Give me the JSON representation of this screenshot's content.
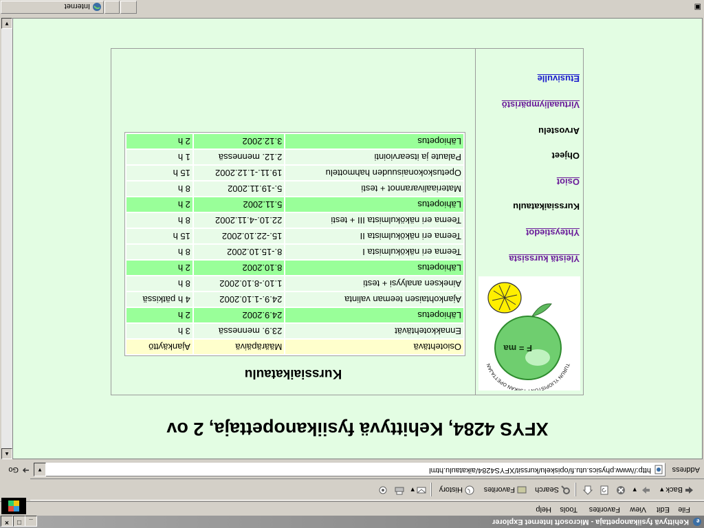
{
  "window": {
    "title": "Kehittyvä fysiikanopettaja - Microsoft Internet Explorer",
    "min_label": "_",
    "max_label": "□",
    "close_label": "×"
  },
  "menu": [
    "File",
    "Edit",
    "View",
    "Favorites",
    "Tools",
    "Help"
  ],
  "toolbar": {
    "back": "Back",
    "forward_icon": "arrow-right-icon",
    "search": "Search",
    "favorites": "Favorites",
    "history": "History"
  },
  "address": {
    "label": "Address",
    "url": "http://www.physics.utu.fi/opiskelu/kurssit/XFYS4284/aikataulu.html",
    "go": "Go"
  },
  "page": {
    "title": "XFYS 4284, Kehittyvä fysiikanopettaja, 2 ov",
    "schedule_title": "Kurssiaikataulu",
    "nav": [
      {
        "label": "Yleistä kurssista",
        "style": "visited"
      },
      {
        "label": "Yhteystiedot",
        "style": "visited"
      },
      {
        "label": "Kurssiaikataulu",
        "style": "plain"
      },
      {
        "label": "Osiot",
        "style": "visited"
      },
      {
        "label": "Ohjeet",
        "style": "plain"
      },
      {
        "label": "Arvostelu",
        "style": "plain"
      },
      {
        "label": "Virtuaaliympäristö",
        "style": "visited"
      },
      {
        "label": "Etusivulle",
        "style": "link"
      }
    ],
    "table_header": [
      "Osiotehtävä",
      "Määräpäivä",
      "Ajankäyttö"
    ],
    "rows": [
      {
        "task": "Ennakkotehtävät",
        "date": "23.9. mennessä",
        "time": "3 h",
        "type": "normal"
      },
      {
        "task": "Lähiopetus",
        "date": "24.9.2002",
        "time": "2 h",
        "type": "contact"
      },
      {
        "task": "Ajankohtaisen teeman valinta",
        "date": "24.9.-1.10.2002",
        "time": "4 h pätkissä",
        "type": "normal"
      },
      {
        "task": "Aineksen analyysi + testi",
        "date": "1.10.-8.10.2002",
        "time": "8 h",
        "type": "normal"
      },
      {
        "task": "Lähiopetus",
        "date": "8.10.2002",
        "time": "2 h",
        "type": "contact"
      },
      {
        "task": "Teema eri näkökulmista I",
        "date": "8.-15.10.2002",
        "time": "8 h",
        "type": "normal"
      },
      {
        "task": "Teema eri näkökulmista II",
        "date": "15.-22.10.2002",
        "time": "15 h",
        "type": "normal"
      },
      {
        "task": "Teema eri näkökulmista III + testi",
        "date": "22.10.-4.11.2002",
        "time": "8 h",
        "type": "normal"
      },
      {
        "task": "Lähiopetus",
        "date": "5.11.2002",
        "time": "2 h",
        "type": "contact"
      },
      {
        "task": "Materiaalivarannot + testi",
        "date": "5.-19.11.2002",
        "time": "8 h",
        "type": "normal"
      },
      {
        "task": "Opetuskokonaisuuden hahmottelu",
        "date": "19.11.-1.12.2002",
        "time": "15 h",
        "type": "normal"
      },
      {
        "task": "Palaute ja itsearviointi",
        "date": "2.12. mennessä",
        "time": "1 h",
        "type": "normal"
      },
      {
        "task": "Lähiopetus",
        "date": "3.12.2002",
        "time": "2 h",
        "type": "contact"
      }
    ],
    "logo_text": "TURUN YLIOPISTON FYSIIKAN OPETTAJAN UNIV",
    "logo_formula": "F = ma"
  },
  "status": {
    "zone": "Internet"
  },
  "colors": {
    "page_bg": "#e3fde3",
    "contact_row": "#99ff99",
    "header_row": "#ffffcc",
    "link": "#1a1acc",
    "visited": "#6a1b9a"
  }
}
